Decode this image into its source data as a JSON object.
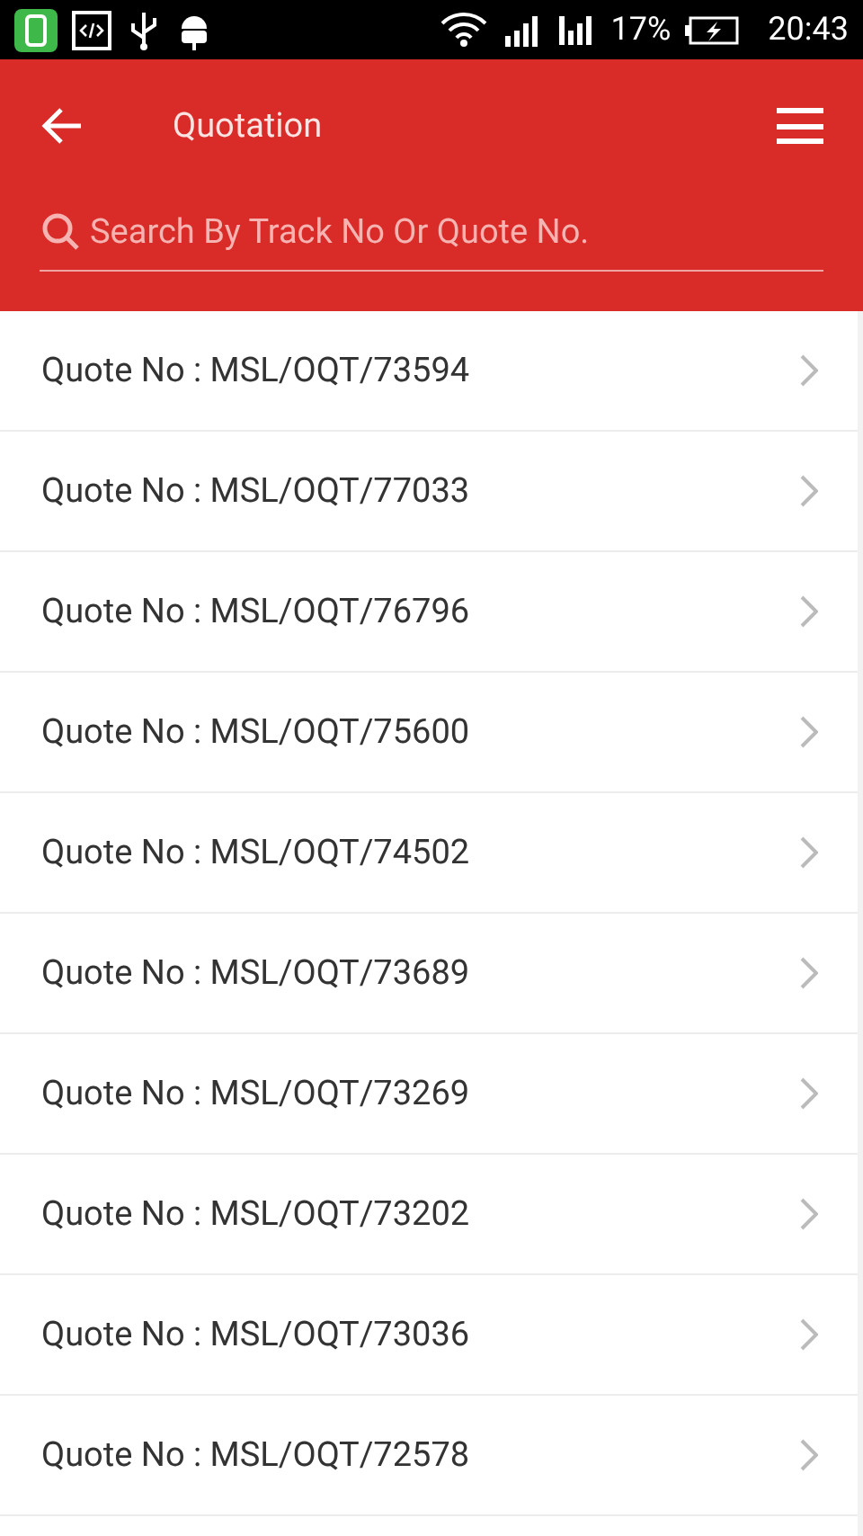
{
  "status_bar": {
    "battery_percent": "17%",
    "time": "20:43"
  },
  "header": {
    "title": "Quotation"
  },
  "search": {
    "placeholder": "Search By Track No Or Quote No."
  },
  "quotes": [
    {
      "label": "Quote No : MSL/OQT/73594"
    },
    {
      "label": "Quote No : MSL/OQT/77033"
    },
    {
      "label": "Quote No : MSL/OQT/76796"
    },
    {
      "label": "Quote No : MSL/OQT/75600"
    },
    {
      "label": "Quote No : MSL/OQT/74502"
    },
    {
      "label": "Quote No : MSL/OQT/73689"
    },
    {
      "label": "Quote No : MSL/OQT/73269"
    },
    {
      "label": "Quote No : MSL/OQT/73202"
    },
    {
      "label": "Quote No : MSL/OQT/73036"
    },
    {
      "label": "Quote No : MSL/OQT/72578"
    }
  ]
}
